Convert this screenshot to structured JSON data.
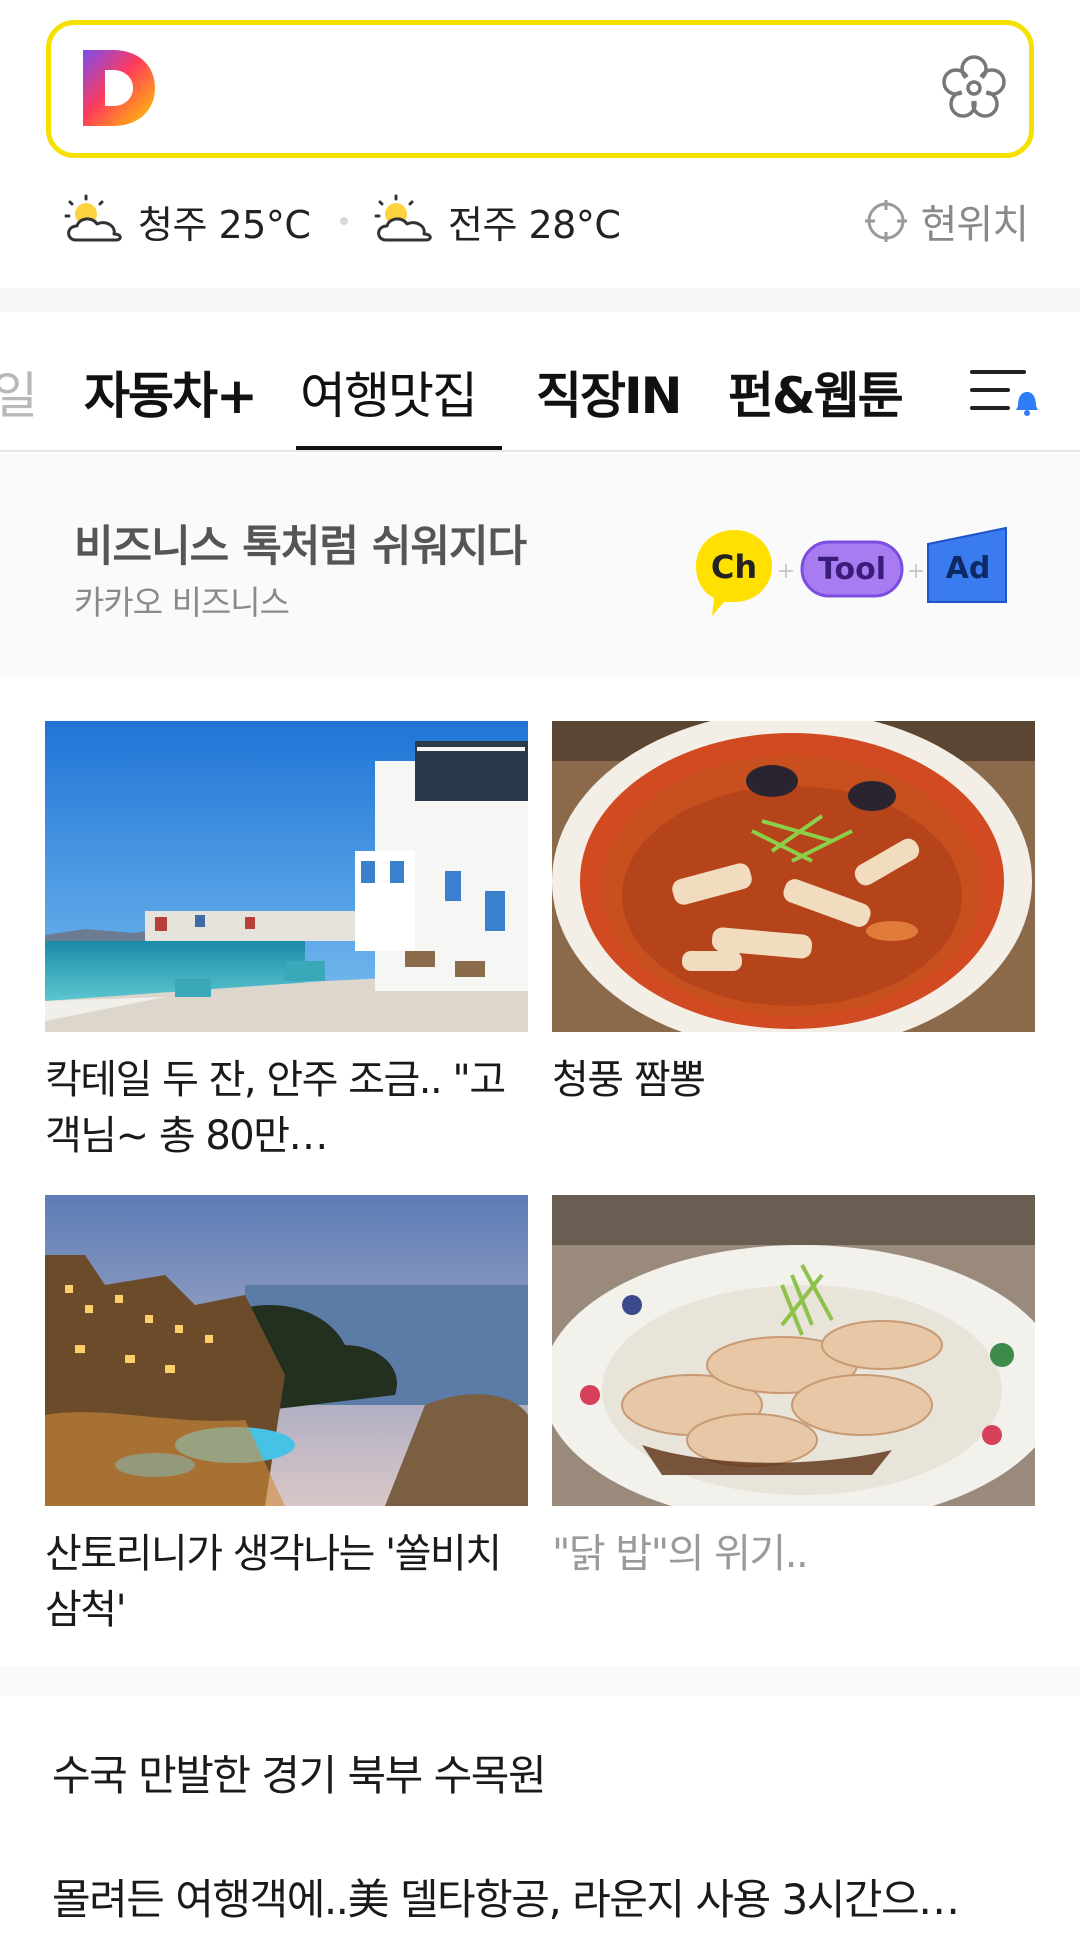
{
  "search": {
    "logo_icon": "daum-logo-icon",
    "action_icon": "flower-icon",
    "accent_color": "#f5e000"
  },
  "weather": [
    {
      "city_temp": "청주 25°C",
      "icon": "partly-cloudy-icon"
    },
    {
      "city_temp": "전주 28°C",
      "icon": "partly-cloudy-icon"
    }
  ],
  "location": {
    "label": "현위치",
    "icon": "crosshair-icon"
  },
  "tabs": [
    {
      "label": "일",
      "state": "partial"
    },
    {
      "label": "자동차+"
    },
    {
      "label": "여행맛집",
      "state": "active"
    },
    {
      "label": "직장IN"
    },
    {
      "label": "펀&웹툰"
    }
  ],
  "menu": {
    "icon": "hamburger-menu-icon",
    "notification_color": "#2e7cf6"
  },
  "promo": {
    "title": "비즈니스 톡처럼 쉬워지다",
    "subtitle": "카카오 비즈니스",
    "badges": [
      "Ch",
      "Tool",
      "Ad"
    ],
    "badge_joiners": [
      "+",
      "+"
    ]
  },
  "cards": [
    {
      "caption": "칵테일 두 잔, 안주 조금.. \"고객님~ 총 80만…",
      "image": "greek-seaside-village"
    },
    {
      "caption": "청풍 짬뽕",
      "image": "jjamppong-noodle-soup"
    },
    {
      "caption": "산토리니가 생각나는 '쏠비치삼척'",
      "image": "resort-coast-at-dusk"
    },
    {
      "caption": "\"닭 밥\"의 위기..",
      "image": "chicken-rice-plate"
    }
  ],
  "headlines": [
    "수국 만발한 경기 북부 수목원",
    "몰려든 여행객에..美 델타항공, 라운지 사용 3시간으…"
  ]
}
